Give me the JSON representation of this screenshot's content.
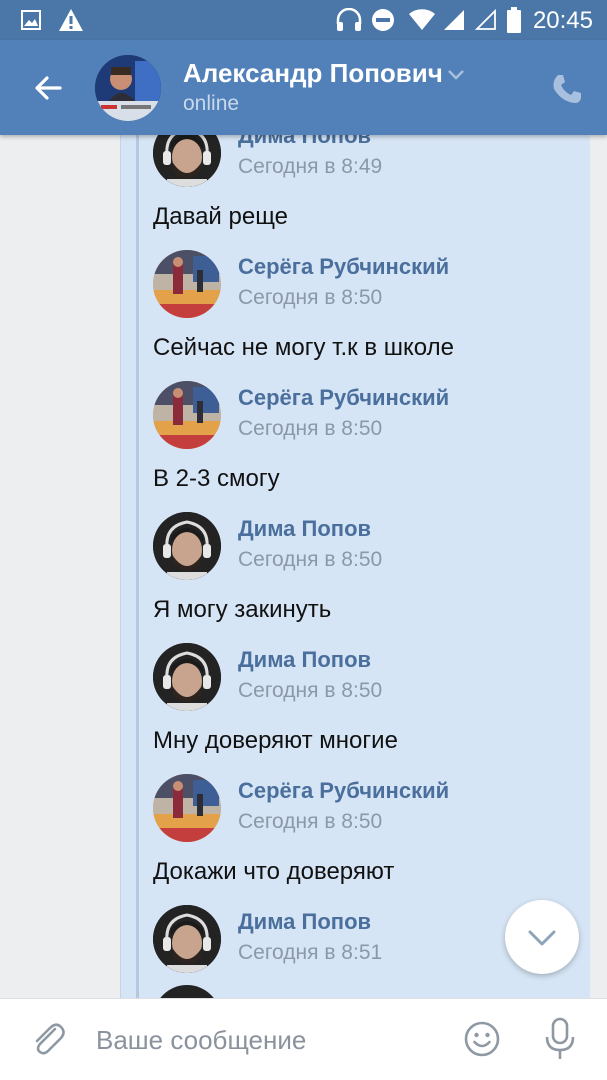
{
  "statusbar": {
    "time": "20:45",
    "icons": [
      "image-notification-icon",
      "warning-icon",
      "headphones-icon",
      "do-not-disturb-icon",
      "wifi-icon",
      "signal-icon",
      "signal-empty-icon",
      "battery-icon"
    ]
  },
  "header": {
    "name": "Александр Попович",
    "status": "online",
    "bg_color": "#5181b8"
  },
  "messages": [
    {
      "author": "Дима Попов",
      "time": "Сегодня в 8:49",
      "text": "Давай  реще",
      "avatar": "dima"
    },
    {
      "author": "Серёга Рубчинский",
      "time": "Сегодня в 8:50",
      "text": "Сейчас не могу т.к в школе",
      "avatar": "serega"
    },
    {
      "author": "Серёга Рубчинский",
      "time": "Сегодня в 8:50",
      "text": "В 2-3 смогу",
      "avatar": "serega"
    },
    {
      "author": "Дима Попов",
      "time": "Сегодня в 8:50",
      "text": "Я могу закинуть",
      "avatar": "dima"
    },
    {
      "author": "Дима Попов",
      "time": "Сегодня в 8:50",
      "text": "Мну доверяют многие",
      "avatar": "dima"
    },
    {
      "author": "Серёга Рубчинский",
      "time": "Сегодня в 8:50",
      "text": "Докажи что доверяют",
      "avatar": "serega"
    },
    {
      "author": "Дима Попов",
      "time": "Сегодня в 8:51",
      "text": "",
      "avatar": "dima"
    }
  ],
  "composer": {
    "placeholder": "Ваше сообщение"
  },
  "colors": {
    "author": "#4a6f9c",
    "time": "#8b98a8",
    "bubble": "#d6e5f5"
  }
}
